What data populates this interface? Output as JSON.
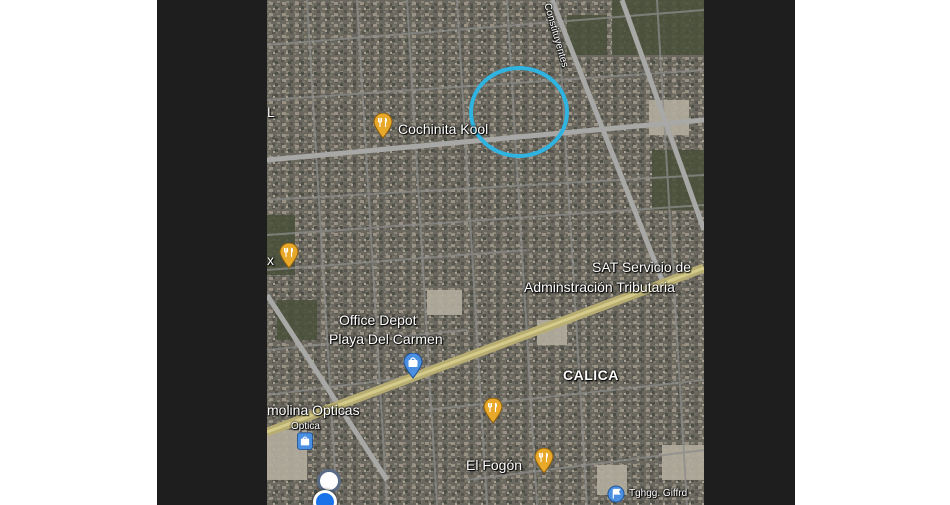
{
  "map": {
    "type": "satellite",
    "road_labels": {
      "constituyentes": "Constituyentes"
    },
    "place_labels": {
      "calica": "CALICA"
    },
    "poi_labels": {
      "cochinita": "Cochinita Kool",
      "sat_line1": "SAT Servicio de",
      "sat_line2": "Adminstración Tributaria",
      "office_depot_line1": "Office Depot",
      "office_depot_line2": "Playa Del Carmen",
      "molina_opticas": "molina Opticas",
      "optica": "Optica",
      "el_fogon": "El Fogón",
      "left_edge_l": "L",
      "left_edge_x": "x",
      "tghgg": "Tghgg. Giffrd"
    },
    "highlight": {
      "color": "#2fb3e0"
    },
    "marker_colors": {
      "restaurant": "#e8a82a",
      "shopping": "#4a8fe0",
      "flag": "#4a8fe0",
      "location": "#1a73e8"
    }
  }
}
